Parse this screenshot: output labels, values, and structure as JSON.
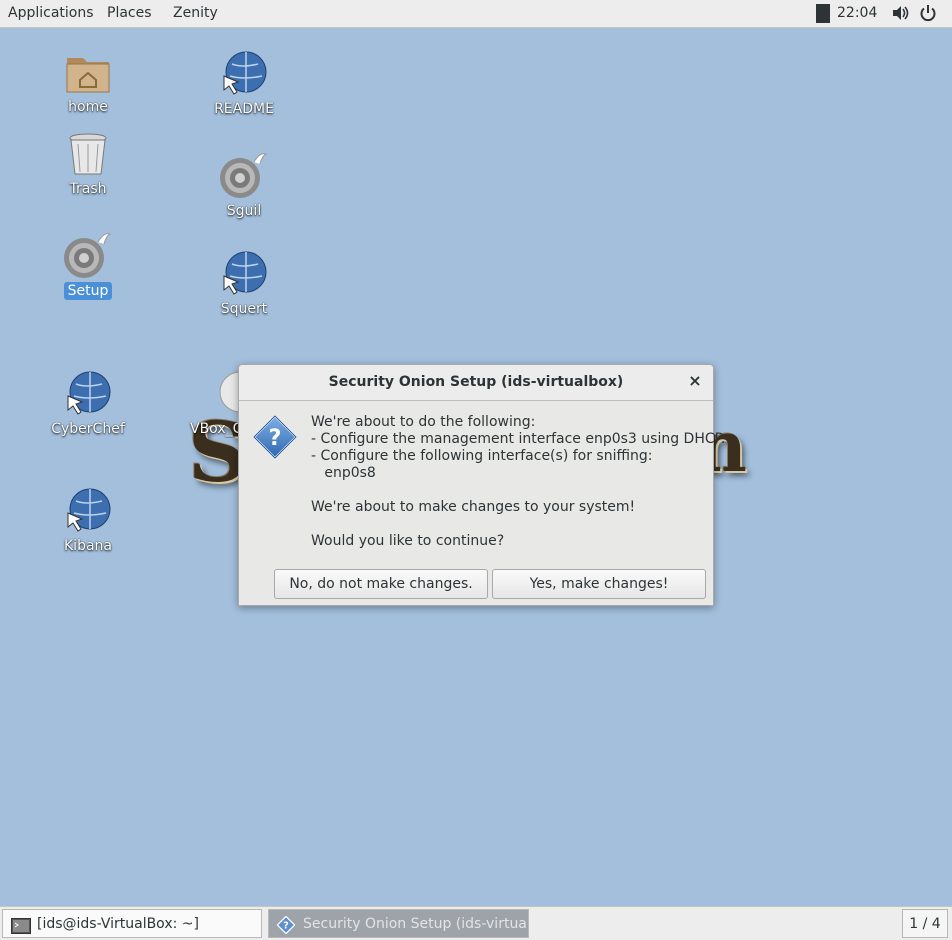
{
  "topbar": {
    "menus": [
      "Applications",
      "Places",
      "Zenity"
    ],
    "clock": "22:04",
    "tray_icons": [
      "volume-icon",
      "power-icon"
    ]
  },
  "desktop": {
    "icons": [
      {
        "label": "home",
        "icon": "folder-home-icon"
      },
      {
        "label": "README",
        "icon": "web-link-icon"
      },
      {
        "label": "Trash",
        "icon": "trash-icon"
      },
      {
        "label": "Sguil",
        "icon": "onion-icon"
      },
      {
        "label": "Setup",
        "icon": "onion-icon"
      },
      {
        "label": "Squert",
        "icon": "web-link-icon"
      },
      {
        "label": "CyberChef",
        "icon": "web-link-icon"
      },
      {
        "label": "VBox_C",
        "icon": "cd-icon"
      },
      {
        "label": "Kibana",
        "icon": "web-link-icon"
      }
    ],
    "wallpaper_text_left": "S",
    "wallpaper_text_right": "n"
  },
  "dialog": {
    "title": "Security Onion Setup (ids-virtualbox)",
    "close_label": "×",
    "icon": "question-icon",
    "message": "We're about to do the following:\n- Configure the management interface enp0s3 using DHCP.\n- Configure the following interface(s) for sniffing:\n   enp0s8\n\nWe're about to make changes to your system!\n\nWould you like to continue?",
    "buttons": {
      "no": "No, do not make changes.",
      "yes": "Yes, make changes!"
    }
  },
  "taskbar": {
    "tasks": [
      {
        "label": "[ids@ids-VirtualBox: ~]",
        "icon": "terminal-icon"
      },
      {
        "label": "Security Onion Setup (ids-virtualbox)",
        "icon": "question-icon"
      }
    ],
    "workspace": "1 / 4"
  },
  "colors": {
    "desktop_bg": "#a3bfdc",
    "selection": "#4a90d9"
  }
}
